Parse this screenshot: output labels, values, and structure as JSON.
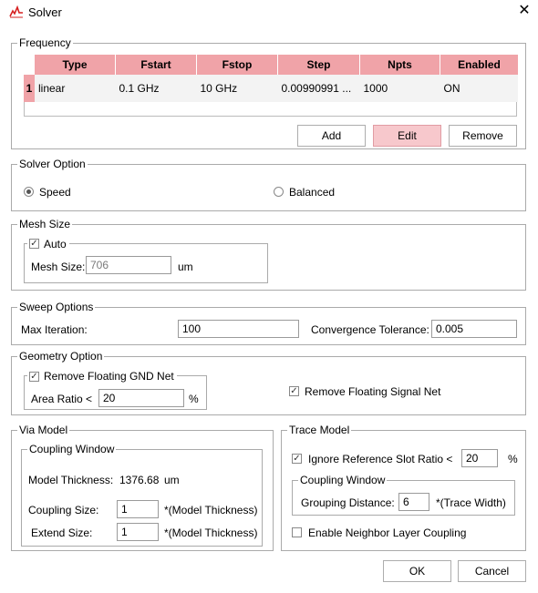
{
  "window": {
    "title": "Solver",
    "close_icon": "close-icon",
    "app_icon": "app-logo-icon"
  },
  "frequency": {
    "legend": "Frequency",
    "columns": [
      "Type",
      "Fstart",
      "Fstop",
      "Step",
      "Npts",
      "Enabled"
    ],
    "rows": [
      {
        "index": "1",
        "cells": [
          "linear",
          "0.1 GHz",
          "10 GHz",
          "0.00990991 ...",
          "1000",
          "ON"
        ]
      }
    ],
    "buttons": {
      "add": "Add",
      "edit": "Edit",
      "remove": "Remove"
    }
  },
  "solver_option": {
    "legend": "Solver Option",
    "speed": "Speed",
    "balanced": "Balanced",
    "selected": "Speed"
  },
  "mesh_size": {
    "legend": "Mesh Size",
    "auto_label": "Auto",
    "auto_checked": true,
    "mesh_size_label": "Mesh Size:",
    "mesh_size_value": "706",
    "unit": "um"
  },
  "sweep_options": {
    "legend": "Sweep Options",
    "max_iteration_label": "Max Iteration:",
    "max_iteration_value": "100",
    "tolerance_label": "Convergence Tolerance:",
    "tolerance_value": "0.005"
  },
  "geometry_option": {
    "legend": "Geometry Option",
    "remove_gnd_label": "Remove Floating GND Net",
    "remove_gnd_checked": true,
    "area_ratio_label": "Area Ratio <",
    "area_ratio_value": "20",
    "area_ratio_unit": "%",
    "remove_signal_label": "Remove Floating Signal Net",
    "remove_signal_checked": true
  },
  "via_model": {
    "legend": "Via Model",
    "coupling_window_legend": "Coupling Window",
    "model_thickness_label": "Model Thickness:",
    "model_thickness_value": "1376.68",
    "model_thickness_unit": "um",
    "coupling_size_label": "Coupling Size:",
    "coupling_size_value": "1",
    "coupling_size_unit": "*(Model Thickness)",
    "extend_size_label": "Extend Size:",
    "extend_size_value": "1",
    "extend_size_unit": "*(Model Thickness)"
  },
  "trace_model": {
    "legend": "Trace Model",
    "ignore_slot_label": "Ignore Reference Slot Ratio <",
    "ignore_slot_checked": true,
    "ignore_slot_value": "20",
    "ignore_slot_unit": "%",
    "coupling_window_legend": "Coupling Window",
    "grouping_distance_label": "Grouping Distance:",
    "grouping_distance_value": "6",
    "grouping_distance_unit": "*(Trace Width)",
    "neighbor_layer_label": "Enable Neighbor Layer Coupling",
    "neighbor_layer_checked": false
  },
  "footer": {
    "ok": "OK",
    "cancel": "Cancel"
  },
  "colors": {
    "table_header": "#f0a3a8",
    "edit_button": "#f7c8cc",
    "group_border": "#aaaaaa"
  }
}
